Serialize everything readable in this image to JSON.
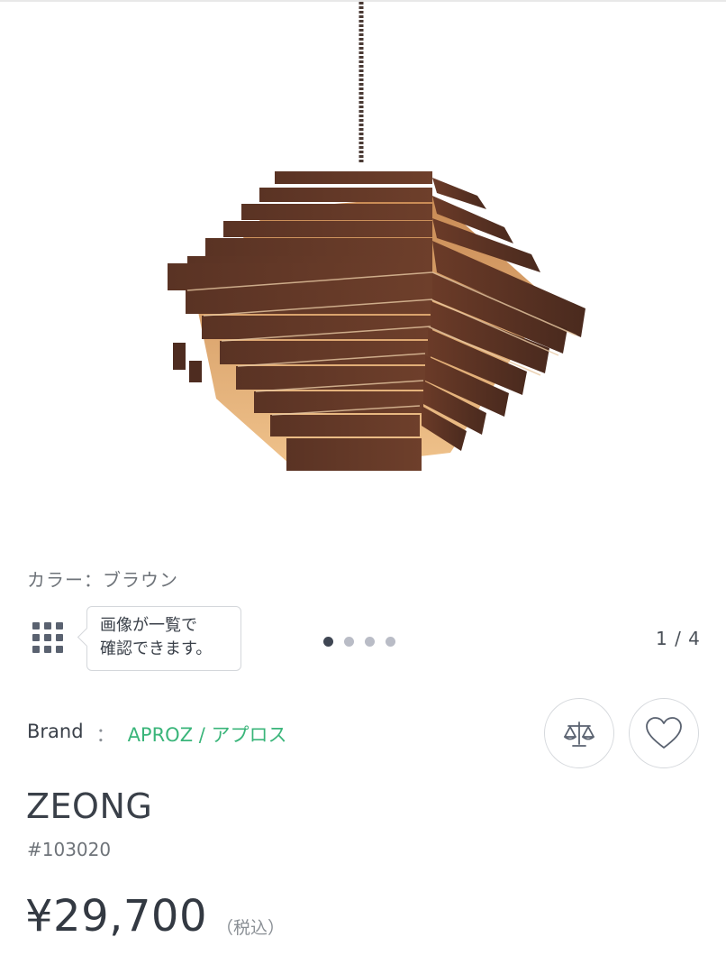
{
  "product": {
    "color_label": "カラー：ブラウン",
    "tooltip_line1": "画像が一覧で",
    "tooltip_line2": "確認できます。",
    "counter": "1 / 4",
    "image_count": 4,
    "active_image": 1,
    "brand_label": "Brand",
    "brand_sep": "：",
    "brand_name": "APROZ / アプロス",
    "name": "ZEONG",
    "code": "#103020",
    "price": "¥29,700",
    "tax_note": "（税込）"
  },
  "icons": {
    "grid": "grid-icon",
    "compare": "balance-scale-icon",
    "favorite": "heart-icon"
  },
  "colors": {
    "brand_link": "#3ab57a",
    "dot_active": "#3f4653",
    "dot_inactive": "#b9bcc6"
  }
}
